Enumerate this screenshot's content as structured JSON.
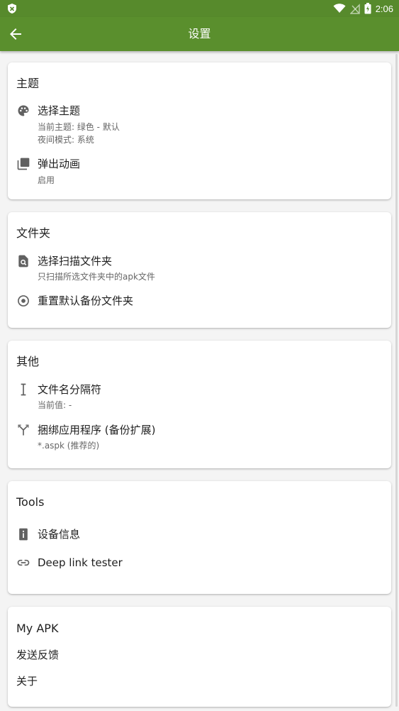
{
  "status_bar": {
    "time": "2:06",
    "icons": [
      "shield-icon",
      "wifi-icon",
      "no-sim-icon",
      "battery-icon"
    ]
  },
  "app_bar": {
    "title": "设置",
    "back_icon": "arrow-back-icon"
  },
  "colors": {
    "primary": "#5a8f2d",
    "status_bar": "#578a2c",
    "background": "#f4f4f4",
    "card": "#ffffff",
    "icon": "#616161"
  },
  "sections": {
    "theme": {
      "title": "主题",
      "items": [
        {
          "label": "选择主题",
          "sub1": "当前主题: 绿色 - 默认",
          "sub2": "夜间模式: 系统",
          "icon": "palette-icon"
        },
        {
          "label": "弹出动画",
          "sub1": "启用",
          "icon": "layers-icon"
        }
      ]
    },
    "folders": {
      "title": "文件夹",
      "items": [
        {
          "label": "选择扫描文件夹",
          "sub1": "只扫描所选文件夹中的apk文件",
          "icon": "find-in-page-icon"
        },
        {
          "label": "重置默认备份文件夹",
          "icon": "radio-target-icon"
        }
      ]
    },
    "other": {
      "title": "其他",
      "items": [
        {
          "label": "文件名分隔符",
          "sub1": "当前值: -",
          "icon": "text-cursor-icon"
        },
        {
          "label": "捆绑应用程序 (备份扩展)",
          "sub1": "*.aspk (推荐的)",
          "icon": "merge-icon"
        }
      ]
    },
    "tools": {
      "title": "Tools",
      "items": [
        {
          "label": "设备信息",
          "icon": "device-info-icon"
        },
        {
          "label": "Deep link tester",
          "icon": "link-icon"
        }
      ]
    },
    "my_apk": {
      "title": "My APK",
      "items": [
        {
          "label": "发送反馈"
        },
        {
          "label": "关于"
        }
      ]
    }
  }
}
